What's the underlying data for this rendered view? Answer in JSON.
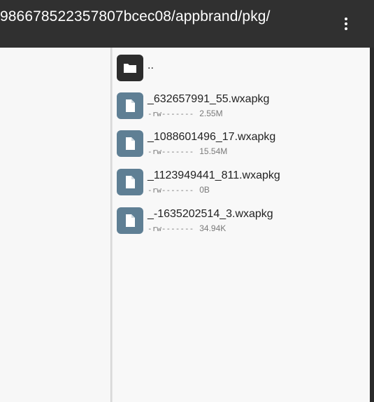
{
  "appbar": {
    "path": "986678522357807bcec08/appbrand/pkg/",
    "overflow_icon": "more-vert-icon"
  },
  "colors": {
    "appbar_bg": "#303030",
    "folder_icon_bg": "#2d2d2d",
    "file_icon_bg": "#5f7f94"
  },
  "files": {
    "parent": {
      "name": "..",
      "icon": "folder-icon"
    },
    "items": [
      {
        "name": "_632657991_55.wxapkg",
        "perm": "-rw-------",
        "size": "2.55M",
        "icon": "file-icon"
      },
      {
        "name": "_1088601496_17.wxapkg",
        "perm": "-rw-------",
        "size": "15.54M",
        "icon": "file-icon"
      },
      {
        "name": "_1123949441_811.wxapkg",
        "perm": "-rw-------",
        "size": "0B",
        "icon": "file-icon"
      },
      {
        "name": "_-1635202514_3.wxapkg",
        "perm": "-rw-------",
        "size": "34.94K",
        "icon": "file-icon"
      }
    ]
  }
}
